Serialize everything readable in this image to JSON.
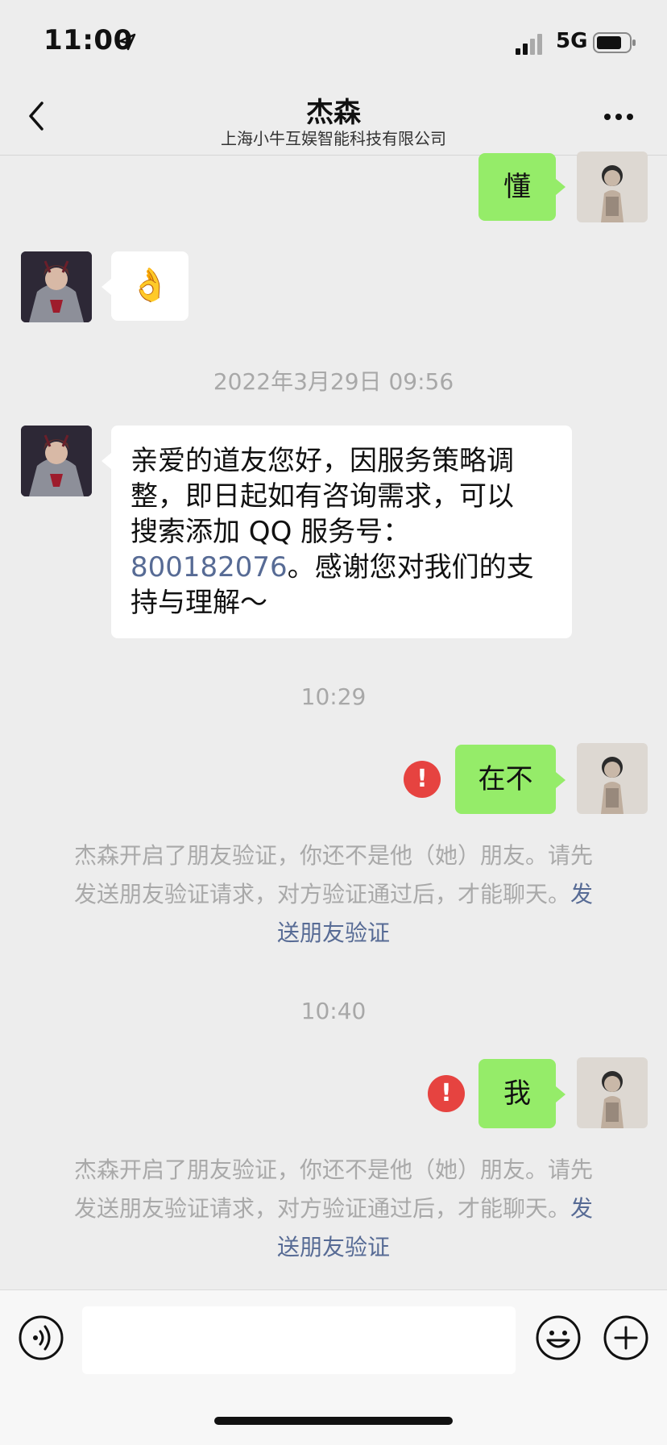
{
  "status_bar": {
    "time": "11:00",
    "network": "5G"
  },
  "nav": {
    "title": "杰森",
    "subtitle": "上海小牛互娱智能科技有限公司"
  },
  "messages": {
    "m1_text": "懂",
    "m2_emoji": "👌",
    "ts1": "2022年3月29日 09:56",
    "m3_line1": "亲爱的道友您好，因服务策略调",
    "m3_line2": "整，即日起如有咨询需求，可以",
    "m3_line3": "搜索添加 QQ 服务号：",
    "m3_line4_link": "800182076",
    "m3_line4_rest": "。感谢您对我们的支",
    "m3_line5": "持与理解～",
    "ts2": "10:29",
    "m4_text": "在不",
    "sys1_line1": "杰森开启了朋友验证，你还不是他（她）朋友。请先",
    "sys1_line2": "发送朋友验证请求，对方验证通过后，才能聊天。",
    "sys1_link_part1": "发",
    "sys1_link_part2": "送朋友验证",
    "ts3": "10:40",
    "m5_text": "我",
    "sys2_line1": "杰森开启了朋友验证，你还不是他（她）朋友。请先",
    "sys2_line2": "发送朋友验证请求，对方验证通过后，才能聊天。",
    "sys2_link_part1": "发",
    "sys2_link_part2": "送朋友验证",
    "error_mark": "!"
  },
  "input": {
    "value": "",
    "placeholder": ""
  },
  "colors": {
    "bubble_mine": "#95ec69",
    "bubble_theirs": "#ffffff",
    "link": "#576b95",
    "error": "#e64340",
    "background": "#ededed"
  },
  "icons": [
    "back-icon",
    "more-icon",
    "voice-icon",
    "emoji-icon",
    "plus-icon",
    "location-arrow-icon",
    "signal-icon",
    "battery-icon"
  ]
}
